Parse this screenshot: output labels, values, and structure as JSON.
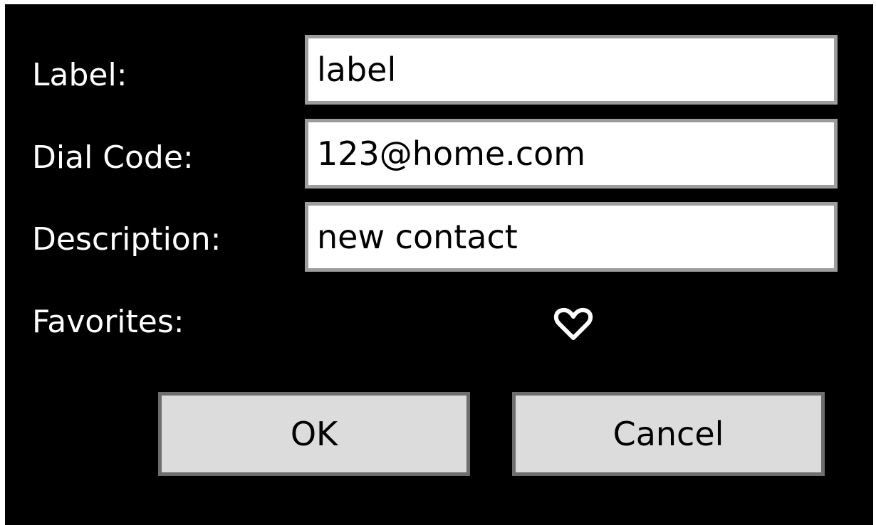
{
  "form": {
    "label_label": "Label:",
    "label_value": "label",
    "dial_code_label": "Dial Code:",
    "dial_code_value": "123@home.com",
    "description_label": "Description:",
    "description_value": "new contact",
    "favorites_label": "Favorites:",
    "favorites_icon": "heart-outline-icon"
  },
  "buttons": {
    "ok_label": "OK",
    "cancel_label": "Cancel"
  },
  "colors": {
    "background": "#000000",
    "label_text": "#ffffff",
    "field_background": "#ffffff",
    "field_border": "#9d9d9d",
    "button_background": "#dcdcdc",
    "button_border": "#6e6e6e"
  }
}
